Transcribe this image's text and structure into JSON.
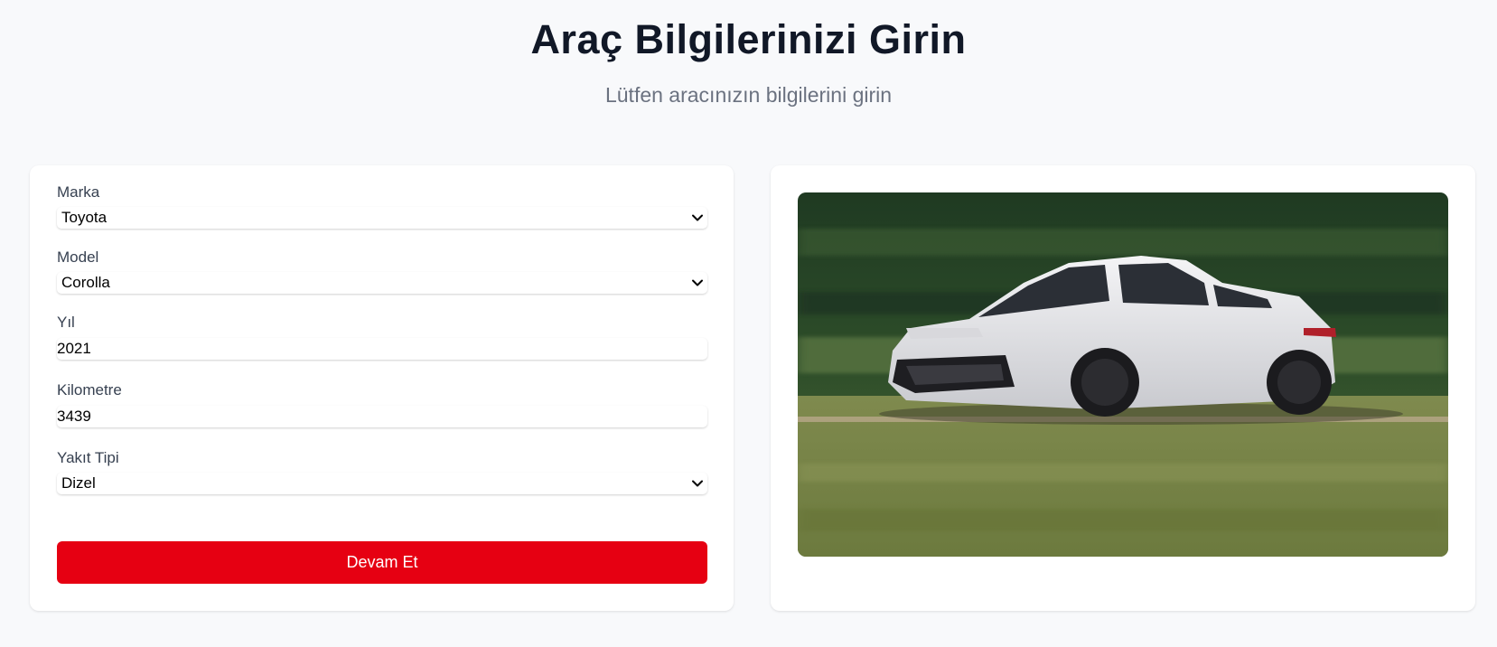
{
  "header": {
    "title": "Araç Bilgilerinizi Girin",
    "subtitle": "Lütfen aracınızın bilgilerini girin"
  },
  "form": {
    "brand": {
      "label": "Marka",
      "value": "Toyota"
    },
    "model": {
      "label": "Model",
      "value": "Corolla"
    },
    "year": {
      "label": "Yıl",
      "value": "2021"
    },
    "mileage": {
      "label": "Kilometre",
      "value": "3439"
    },
    "fuel_type": {
      "label": "Yakıt Tipi",
      "value": "Dizel"
    },
    "submit_label": "Devam Et"
  },
  "icons": {
    "select_arrow": "chevron-down-icon"
  },
  "colors": {
    "accent": "#e60012",
    "background": "#f8f9fb",
    "title": "#111827",
    "subtitle": "#6b7280"
  }
}
